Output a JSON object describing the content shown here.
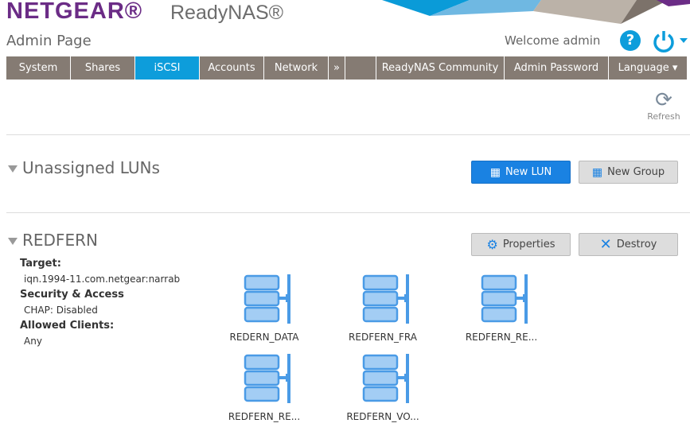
{
  "header": {
    "brand": "NETGEAR®",
    "product": "ReadyNAS®",
    "page_title": "Admin Page",
    "welcome": "Welcome admin"
  },
  "nav": {
    "tabs": [
      "System",
      "Shares",
      "iSCSI",
      "Accounts",
      "Network",
      "»",
      "",
      "ReadyNAS Community",
      "Admin Password",
      "Language ▾"
    ],
    "active": "iSCSI"
  },
  "toolbar": {
    "refresh": "Refresh"
  },
  "unassigned": {
    "title": "Unassigned LUNs",
    "new_lun": "New LUN",
    "new_group": "New Group"
  },
  "group": {
    "title": "REDFERN",
    "properties": "Properties",
    "destroy": "Destroy",
    "target_label": "Target:",
    "target": "iqn.1994-11.com.netgear:narrab",
    "security_label": "Security & Access",
    "security": "CHAP: Disabled",
    "clients_label": "Allowed Clients:",
    "clients": "Any",
    "luns": [
      "REDERN_DATA",
      "REDFERN_FRA",
      "REDFERN_RE...",
      "REDFERN_RE...",
      "REDFERN_VO..."
    ]
  },
  "colors": {
    "accent": "#0d9ddb",
    "brand": "#6b2c86",
    "nav": "#857b73"
  }
}
